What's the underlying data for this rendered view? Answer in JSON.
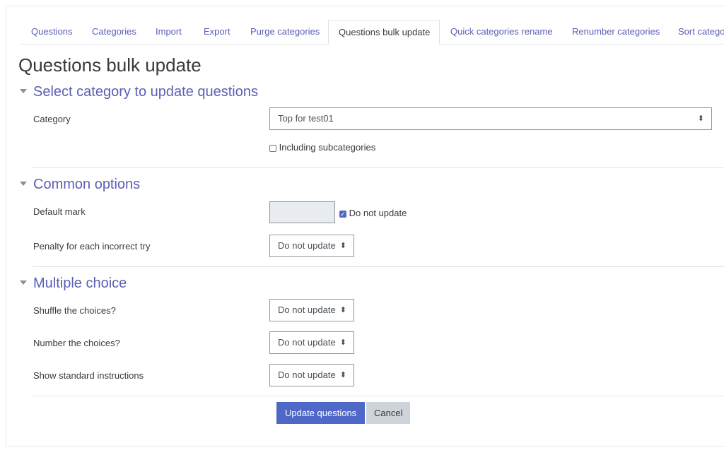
{
  "tabs": [
    {
      "label": "Questions",
      "active": false
    },
    {
      "label": "Categories",
      "active": false
    },
    {
      "label": "Import",
      "active": false
    },
    {
      "label": "Export",
      "active": false
    },
    {
      "label": "Purge categories",
      "active": false
    },
    {
      "label": "Questions bulk update",
      "active": true
    },
    {
      "label": "Quick categories rename",
      "active": false
    },
    {
      "label": "Renumber categories",
      "active": false
    },
    {
      "label": "Sort categories",
      "active": false
    }
  ],
  "page_title": "Questions bulk update",
  "sections": {
    "select": {
      "heading": "Select category to update questions",
      "category_label": "Category",
      "category_value": "Top for test01",
      "subcat_label": "Including subcategories",
      "subcat_checked": false
    },
    "common": {
      "heading": "Common options",
      "default_mark_label": "Default mark",
      "default_mark_value": "",
      "dnu_label": "Do not update",
      "dnu_checked": true,
      "penalty_label": "Penalty for each incorrect try",
      "penalty_value": "Do not update"
    },
    "mc": {
      "heading": "Multiple choice",
      "shuffle_label": "Shuffle the choices?",
      "shuffle_value": "Do not update",
      "number_label": "Number the choices?",
      "number_value": "Do not update",
      "instr_label": "Show standard instructions",
      "instr_value": "Do not update"
    }
  },
  "buttons": {
    "submit": "Update questions",
    "cancel": "Cancel"
  },
  "colors": {
    "accent": "#5a5fb5",
    "primary_button": "#4f68c8",
    "secondary_button": "#ced4da"
  }
}
